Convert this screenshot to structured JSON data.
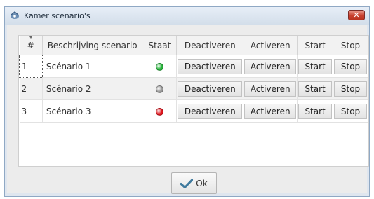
{
  "window": {
    "title": "Kamer scenario's",
    "close_label": "✕"
  },
  "table": {
    "columns": [
      "#",
      "Beschrijving scenario",
      "Staat",
      "Deactiveren",
      "Activeren",
      "Start",
      "Stop"
    ],
    "rows": [
      {
        "num": "1",
        "description": "Scénario 1",
        "state": "green",
        "deactivate": "Deactiveren",
        "activate": "Activeren",
        "start": "Start",
        "stop": "Stop"
      },
      {
        "num": "2",
        "description": "Scénario 2",
        "state": "gray",
        "deactivate": "Deactiveren",
        "activate": "Activeren",
        "start": "Start",
        "stop": "Stop"
      },
      {
        "num": "3",
        "description": "Scénario 3",
        "state": "red",
        "deactivate": "Deactiveren",
        "activate": "Activeren",
        "start": "Start",
        "stop": "Stop"
      }
    ]
  },
  "state_colors": {
    "green": "#26b33a",
    "gray": "#9a9a9a",
    "red": "#e0141c"
  },
  "footer": {
    "ok_label": "Ok",
    "ok_icon": "checkmark-icon"
  }
}
